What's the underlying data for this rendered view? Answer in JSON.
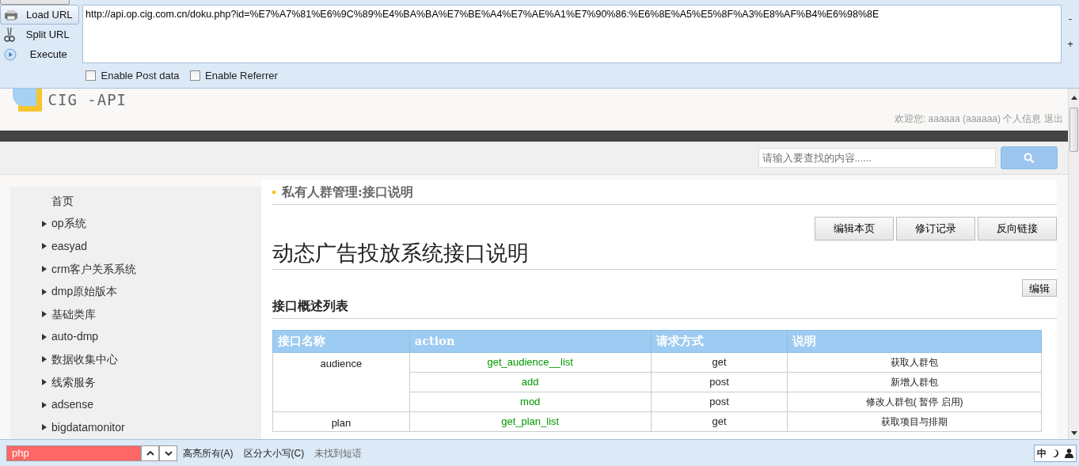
{
  "toolbar": {
    "buttons": [
      {
        "label": "Load URL",
        "kind": "load",
        "selected": true
      },
      {
        "label": "Split URL",
        "kind": "split",
        "selected": false
      },
      {
        "label": "Execute",
        "kind": "execute",
        "selected": false
      }
    ],
    "url": "http://api.op.cig.com.cn/doku.php?id=%E7%A7%81%E6%9C%89%E4%BA%BA%E7%BE%A4%E7%AE%A1%E7%90%86:%E6%8E%A5%E5%8F%A3%E8%AF%B4%E6%98%8E",
    "side_buttons": [
      "-",
      "+"
    ],
    "options": [
      {
        "label": "Enable Post data",
        "checked": false
      },
      {
        "label": "Enable Referrer",
        "checked": false
      }
    ]
  },
  "site": {
    "logo": "CIG -API",
    "welcome": "欢迎您:",
    "user": "aaaaaa (aaaaaa)",
    "links": [
      "个人信息",
      "退出"
    ],
    "search_placeholder": "请输入要查找的内容......"
  },
  "sidebar": {
    "items": [
      {
        "label": "首页",
        "expandable": false
      },
      {
        "label": "op系统",
        "expandable": true
      },
      {
        "label": "easyad",
        "expandable": true
      },
      {
        "label": "crm客户关系系统",
        "expandable": true
      },
      {
        "label": "dmp原始版本",
        "expandable": true
      },
      {
        "label": "基础类库",
        "expandable": true
      },
      {
        "label": "auto-dmp",
        "expandable": true
      },
      {
        "label": "数据收集中心",
        "expandable": true
      },
      {
        "label": "线索服务",
        "expandable": true
      },
      {
        "label": "adsense",
        "expandable": true
      },
      {
        "label": "bigdatamonitor",
        "expandable": true
      }
    ]
  },
  "page": {
    "breadcrumb": "私有人群管理:接口说明",
    "actions": [
      "编辑本页",
      "修订记录",
      "反向链接"
    ],
    "title": "动态广告投放系统接口说明",
    "edit": "编辑",
    "section": "接口概述列表",
    "table": {
      "columns": [
        "接口名称",
        "action",
        "请求方式",
        "说明"
      ],
      "groups": [
        {
          "name": "audience",
          "rows": [
            {
              "action": "get_audience__list",
              "method": "get",
              "description": "获取人群包"
            },
            {
              "action": "add",
              "method": "post",
              "description": "新增人群包"
            },
            {
              "action": "mod",
              "method": "post",
              "description": "修改人群包( 暂停 启用)"
            }
          ]
        },
        {
          "name": "plan",
          "rows": [
            {
              "action": "get_plan_list",
              "method": "get",
              "description": "获取项目与排期"
            }
          ]
        }
      ]
    }
  },
  "find_bar": {
    "query": "php",
    "not_found": true,
    "options": [
      "高亮所有(A)",
      "区分大小写(C)"
    ],
    "status": "未找到短语"
  },
  "ime": {
    "mode": "中"
  }
}
